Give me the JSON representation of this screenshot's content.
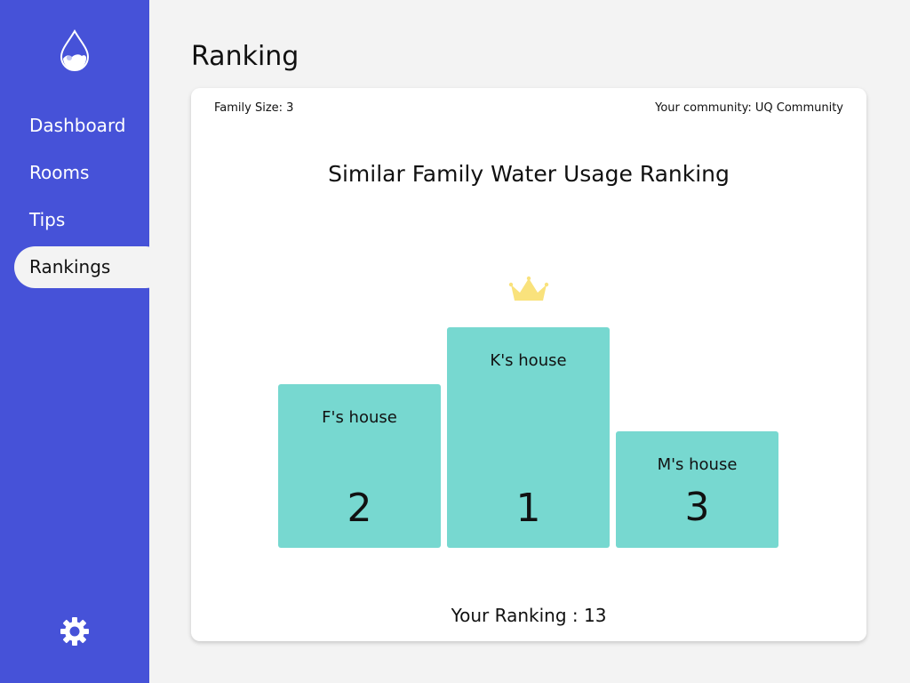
{
  "sidebar": {
    "logo_icon": "water-drop-icon",
    "items": [
      {
        "label": "Dashboard",
        "active": false
      },
      {
        "label": "Rooms",
        "active": false
      },
      {
        "label": "Tips",
        "active": false
      },
      {
        "label": "Rankings",
        "active": true
      }
    ],
    "settings_icon": "gear-icon"
  },
  "page": {
    "title": "Ranking"
  },
  "card": {
    "family_size": "Family Size: 3",
    "community": "Your community: UQ Community",
    "title": "Similar Family Water Usage Ranking",
    "crown_icon": "crown-icon",
    "podium": [
      {
        "house": "F's house",
        "rank": "2"
      },
      {
        "house": "K's house",
        "rank": "1"
      },
      {
        "house": "M's house",
        "rank": "3"
      }
    ],
    "your_ranking": "Your Ranking : 13"
  },
  "colors": {
    "sidebar": "#4652d8",
    "podium": "#77d8d0",
    "crown": "#f9e27c",
    "background": "#f3f3f3"
  }
}
